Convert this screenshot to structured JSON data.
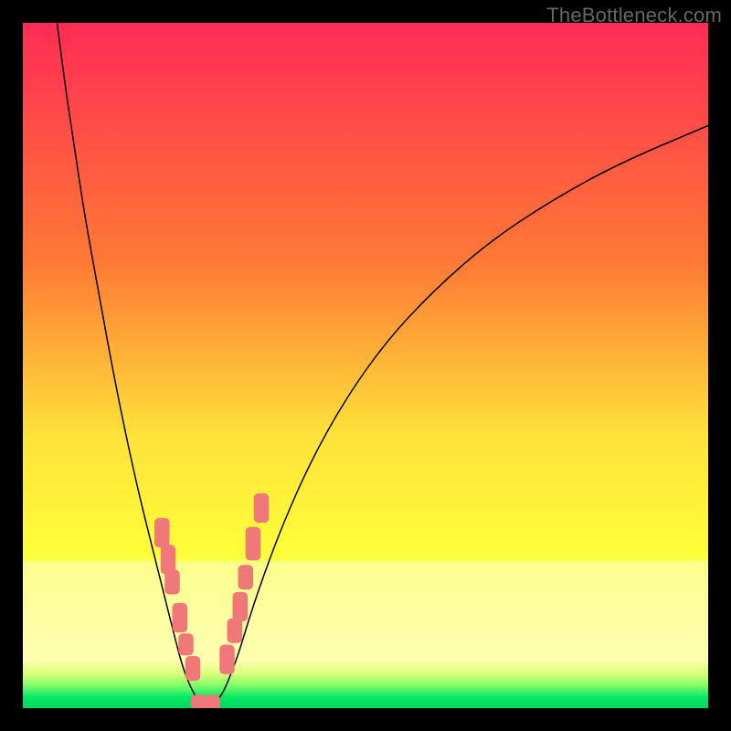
{
  "watermark": "TheBottleneck.com",
  "chart_data": {
    "type": "line",
    "title": "",
    "xlabel": "",
    "ylabel": "",
    "xlim": [
      0,
      100
    ],
    "ylim": [
      0,
      100
    ],
    "grid": false,
    "legend": false,
    "background_gradient_stops": [
      {
        "offset": 0,
        "color": "#ff2b55"
      },
      {
        "offset": 0.35,
        "color": "#ff7a35"
      },
      {
        "offset": 0.6,
        "color": "#ffe13a"
      },
      {
        "offset": 0.78,
        "color": "#ffff3a"
      },
      {
        "offset": 0.79,
        "color": "#fbff8e"
      },
      {
        "offset": 0.93,
        "color": "#ffffb0"
      },
      {
        "offset": 0.95,
        "color": "#d8ff7a"
      },
      {
        "offset": 0.965,
        "color": "#8cff6a"
      },
      {
        "offset": 0.985,
        "color": "#00e865"
      },
      {
        "offset": 1.0,
        "color": "#00d858"
      }
    ],
    "series": [
      {
        "name": "bottleneck-curve",
        "stroke": "#000000",
        "stroke_width": 1.5,
        "points": [
          {
            "x": 5.0,
            "y": 100.0
          },
          {
            "x": 6.0,
            "y": 92.0
          },
          {
            "x": 7.5,
            "y": 82.0
          },
          {
            "x": 9.0,
            "y": 72.0
          },
          {
            "x": 11.0,
            "y": 61.0
          },
          {
            "x": 13.0,
            "y": 50.0
          },
          {
            "x": 15.0,
            "y": 40.0
          },
          {
            "x": 17.0,
            "y": 31.0
          },
          {
            "x": 19.0,
            "y": 23.0
          },
          {
            "x": 20.5,
            "y": 17.0
          },
          {
            "x": 22.0,
            "y": 11.0
          },
          {
            "x": 23.3,
            "y": 6.0
          },
          {
            "x": 24.5,
            "y": 3.0
          },
          {
            "x": 25.5,
            "y": 1.2
          },
          {
            "x": 26.5,
            "y": 0.5
          },
          {
            "x": 27.5,
            "y": 0.5
          },
          {
            "x": 28.8,
            "y": 1.5
          },
          {
            "x": 30.0,
            "y": 4.0
          },
          {
            "x": 31.5,
            "y": 8.0
          },
          {
            "x": 33.0,
            "y": 13.0
          },
          {
            "x": 35.0,
            "y": 19.0
          },
          {
            "x": 38.0,
            "y": 27.0
          },
          {
            "x": 42.0,
            "y": 36.0
          },
          {
            "x": 47.0,
            "y": 45.0
          },
          {
            "x": 53.0,
            "y": 53.5
          },
          {
            "x": 60.0,
            "y": 61.0
          },
          {
            "x": 68.0,
            "y": 68.0
          },
          {
            "x": 77.0,
            "y": 74.0
          },
          {
            "x": 87.0,
            "y": 79.5
          },
          {
            "x": 100.0,
            "y": 85.0
          }
        ]
      }
    ],
    "markers": {
      "fill": "#f07878",
      "rx": 5,
      "points": [
        {
          "x": 20.3,
          "y": 25.6,
          "w": 2.2,
          "h": 4.3
        },
        {
          "x": 21.2,
          "y": 21.7,
          "w": 2.2,
          "h": 4.3
        },
        {
          "x": 21.8,
          "y": 18.4,
          "w": 2.2,
          "h": 3.6
        },
        {
          "x": 22.9,
          "y": 13.2,
          "w": 2.2,
          "h": 4.3
        },
        {
          "x": 23.8,
          "y": 9.3,
          "w": 2.2,
          "h": 3.2
        },
        {
          "x": 24.8,
          "y": 5.8,
          "w": 2.2,
          "h": 3.6
        },
        {
          "x": 25.7,
          "y": 0.9,
          "w": 2.4,
          "h": 2.1
        },
        {
          "x": 27.6,
          "y": 0.9,
          "w": 2.4,
          "h": 2.1
        },
        {
          "x": 29.8,
          "y": 7.1,
          "w": 2.2,
          "h": 4.3
        },
        {
          "x": 30.9,
          "y": 11.3,
          "w": 2.2,
          "h": 3.6
        },
        {
          "x": 31.7,
          "y": 14.8,
          "w": 2.2,
          "h": 4.3
        },
        {
          "x": 32.5,
          "y": 19.1,
          "w": 2.2,
          "h": 3.6
        },
        {
          "x": 33.6,
          "y": 24.0,
          "w": 2.2,
          "h": 4.9
        },
        {
          "x": 34.8,
          "y": 29.2,
          "w": 2.2,
          "h": 4.3
        }
      ]
    }
  }
}
